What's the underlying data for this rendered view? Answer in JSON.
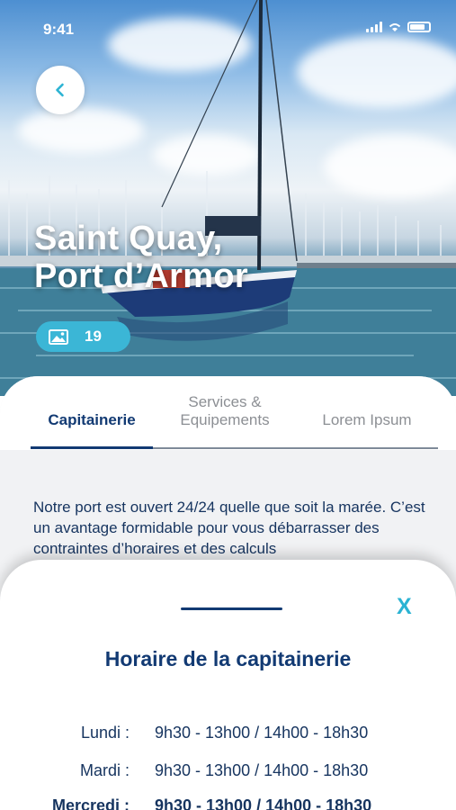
{
  "status_bar": {
    "time": "9:41"
  },
  "hero": {
    "title_line1": "Saint Quay,",
    "title_line2": "Port d’Armor",
    "photo_count": "19"
  },
  "tabs": [
    {
      "label": "Capitainerie",
      "active": true
    },
    {
      "label_line1": "Services &",
      "label_line2": "Equipements",
      "active": false
    },
    {
      "label": "Lorem Ipsum",
      "active": false
    }
  ],
  "description": "Notre port est ouvert 24/24 quelle que soit la marée. C’est un avantage formidable pour vous débarrasser des contraintes d’horaires et des calculs",
  "sheet": {
    "close_label": "X",
    "title": "Horaire de la capitainerie",
    "hours": [
      {
        "day": "Lundi :",
        "time": "9h30 - 13h00 / 14h00 - 18h30"
      },
      {
        "day": "Mardi :",
        "time": "9h30 - 13h00 / 14h00 - 18h30"
      },
      {
        "day": "Mercredi :",
        "time": "9h30 - 13h00 / 14h00 - 18h30"
      }
    ]
  },
  "colors": {
    "primary_navy": "#123a73",
    "accent_cyan": "#3bb6d6",
    "panel_bg": "#f1f2f4"
  },
  "icons": {
    "back": "chevron-left-icon",
    "gallery": "image-icon",
    "close": "close-icon"
  }
}
